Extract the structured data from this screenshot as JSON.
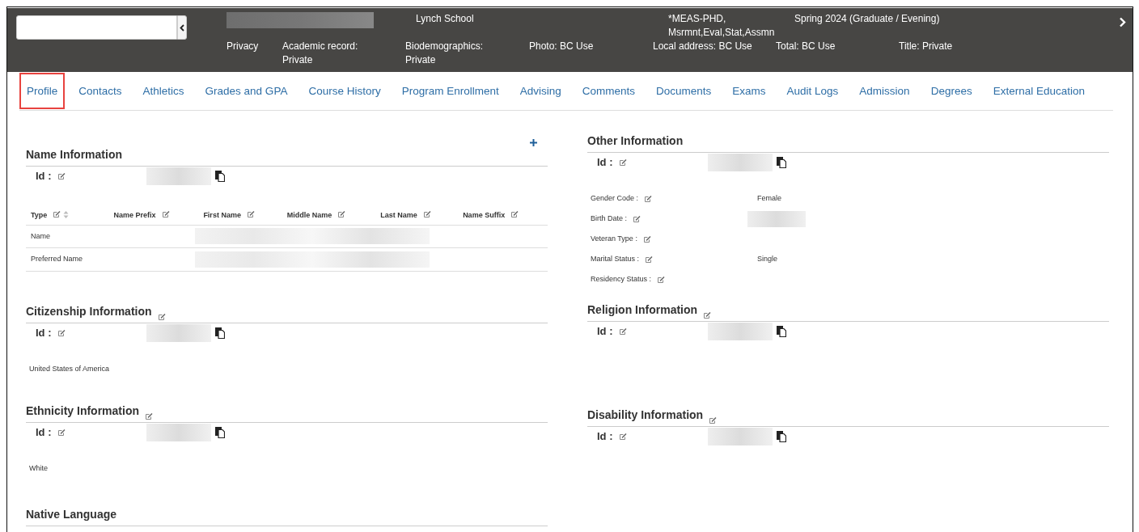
{
  "header": {
    "top": [
      {
        "kind": "redacted"
      },
      {
        "kind": "text",
        "text": "Lynch School"
      },
      {
        "kind": "text",
        "text": "*MEAS-PHD, Msrmnt,Eval,Stat,Assmn"
      },
      {
        "kind": "text",
        "text": "Spring 2024 (Graduate / Evening)"
      }
    ],
    "privacy": [
      "Privacy",
      "Academic record: Private",
      "Biodemographics: Private",
      "Photo: BC Use",
      "Local address: BC Use",
      "Total: BC Use",
      "Title: Private"
    ]
  },
  "tabs": [
    {
      "label": "Profile",
      "selected": true
    },
    {
      "label": "Contacts",
      "selected": false
    },
    {
      "label": "Athletics",
      "selected": false
    },
    {
      "label": "Grades and GPA",
      "selected": false
    },
    {
      "label": "Course History",
      "selected": false
    },
    {
      "label": "Program Enrollment",
      "selected": false
    },
    {
      "label": "Advising",
      "selected": false
    },
    {
      "label": "Comments",
      "selected": false
    },
    {
      "label": "Documents",
      "selected": false
    },
    {
      "label": "Exams",
      "selected": false
    },
    {
      "label": "Audit Logs",
      "selected": false
    },
    {
      "label": "Admission",
      "selected": false
    },
    {
      "label": "Degrees",
      "selected": false
    },
    {
      "label": "External Education",
      "selected": false
    }
  ],
  "left_sections": [
    {
      "title": "Name Information",
      "editable": false,
      "add": true,
      "id_label": "Id :",
      "kind": "table",
      "columns": [
        {
          "label": "Type",
          "sortable": true
        },
        {
          "label": "Name Prefix",
          "sortable": false
        },
        {
          "label": "First Name",
          "sortable": false
        },
        {
          "label": "Middle Name",
          "sortable": false
        },
        {
          "label": "Last Name",
          "sortable": false
        },
        {
          "label": "Name Suffix",
          "sortable": false
        }
      ],
      "rows": [
        "Name",
        "Preferred Name"
      ]
    },
    {
      "title": "Citizenship Information",
      "editable": true,
      "add": false,
      "id_label": "Id :",
      "kind": "value",
      "value": "United States of America"
    },
    {
      "title": "Ethnicity Information",
      "editable": true,
      "add": false,
      "id_label": "Id :",
      "kind": "value",
      "value": "White"
    },
    {
      "title": "Native Language",
      "editable": false,
      "add": false,
      "kind": "cut"
    }
  ],
  "right_sections": [
    {
      "title": "Other Information",
      "editable": false,
      "add": false,
      "id_label": "Id :",
      "kind": "fields",
      "fields": [
        {
          "kind": "value",
          "label": "Gender Code :",
          "value": "Female"
        },
        {
          "kind": "redacted",
          "label": "Birth Date :"
        },
        {
          "kind": "blank",
          "label": "Veteran Type :"
        },
        {
          "kind": "value",
          "label": "Marital Status :",
          "value": "Single"
        },
        {
          "kind": "blank",
          "label": "Residency Status :"
        }
      ]
    },
    {
      "title": "Religion Information",
      "editable": true,
      "add": false,
      "id_label": "Id :",
      "kind": "empty"
    },
    {
      "title": "Disability Information",
      "editable": true,
      "add": false,
      "id_label": "Id :",
      "kind": "empty"
    }
  ]
}
